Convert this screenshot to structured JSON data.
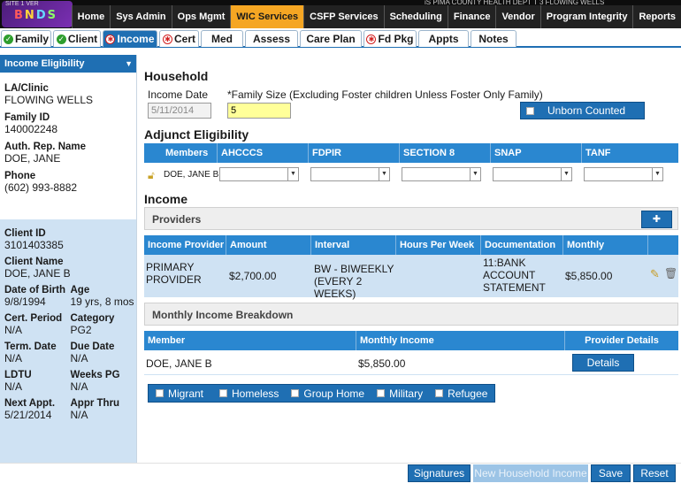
{
  "header": {
    "top_strip_text": "iS   PIMA COUNTY HEALTH DEPT T 3   FLOWING WELLS",
    "logo_top": "SITE 1 VER",
    "logo_letters": [
      "B",
      "N",
      "D",
      "S"
    ],
    "nav": [
      "Home",
      "Sys Admin",
      "Ops Mgmt",
      "WIC Services",
      "CSFP Services",
      "Scheduling",
      "Finance",
      "Vendor",
      "Program Integrity",
      "Reports"
    ],
    "nav_active": "WIC Services"
  },
  "tabs": [
    {
      "label": "Family",
      "status": "ok"
    },
    {
      "label": "Client",
      "status": "ok"
    },
    {
      "label": "Income",
      "status": "error",
      "active": true
    },
    {
      "label": "Cert",
      "status": "error"
    },
    {
      "label": "Med",
      "status": "none"
    },
    {
      "label": "Assess",
      "status": "none"
    },
    {
      "label": "Care Plan",
      "status": "none"
    },
    {
      "label": "Fd Pkg",
      "status": "error"
    },
    {
      "label": "Appts",
      "status": "none"
    },
    {
      "label": "Notes",
      "status": "none"
    }
  ],
  "left": {
    "header": "Income Eligibility",
    "la_clinic_label": "LA/Clinic",
    "la_clinic_value": "FLOWING WELLS",
    "family_id_label": "Family ID",
    "family_id_value": "140002248",
    "auth_rep_label": "Auth. Rep. Name",
    "auth_rep_value": "DOE, JANE",
    "phone_label": "Phone",
    "phone_value": "(602) 993-8882",
    "client_id_label": "Client ID",
    "client_id_value": "3101403385",
    "client_name_label": "Client Name",
    "client_name_value": "DOE, JANE B",
    "dob_label": "Date of Birth",
    "dob_value": "9/8/1994",
    "age_label": "Age",
    "age_value": "19 yrs, 8 mos",
    "cert_period_label": "Cert. Period",
    "cert_period_value": "N/A",
    "category_label": "Category",
    "category_value": "PG2",
    "term_date_label": "Term. Date",
    "term_date_value": "N/A",
    "due_date_label": "Due Date",
    "due_date_value": "N/A",
    "ldtu_label": "LDTU",
    "ldtu_value": "N/A",
    "weeks_pg_label": "Weeks PG",
    "weeks_pg_value": "N/A",
    "next_appt_label": "Next Appt.",
    "next_appt_value": "5/21/2014",
    "appr_thru_label": "Appr Thru",
    "appr_thru_value": "N/A"
  },
  "household": {
    "title": "Household",
    "income_date_label": "Income Date",
    "income_date_value": "5/11/2014",
    "family_size_label": "*Family Size (Excluding Foster children Unless Foster Only Family)",
    "family_size_value": "5",
    "unborn_label": "Unborn Counted"
  },
  "adjunct": {
    "title": "Adjunct Eligibility",
    "columns": [
      "Members",
      "AHCCCS",
      "FDPIR",
      "SECTION 8",
      "SNAP",
      "TANF"
    ],
    "member": "DOE, JANE B"
  },
  "income": {
    "title": "Income",
    "providers_title": "Providers",
    "add_label": "Add",
    "columns": [
      "Income Provider",
      "Amount",
      "Interval",
      "Hours Per Week",
      "Documentation",
      "Monthly"
    ],
    "row": {
      "provider": "PRIMARY PROVIDER",
      "amount": "$2,700.00",
      "interval": "BW - BIWEEKLY (EVERY 2 WEEKS)",
      "hours": "",
      "documentation": "11:BANK ACCOUNT STATEMENT",
      "monthly": "$5,850.00"
    },
    "breakdown_title": "Monthly Income Breakdown",
    "breakdown_columns": [
      "Member",
      "Monthly Income",
      "Provider Details"
    ],
    "breakdown_row": {
      "member": "DOE, JANE B",
      "monthly": "$5,850.00",
      "details": "Details"
    }
  },
  "flags": [
    "Migrant",
    "Homeless",
    "Group Home",
    "Military",
    "Refugee"
  ],
  "footer": {
    "signatures": "Signatures",
    "new_household": "New Household Income",
    "save": "Save",
    "reset": "Reset"
  },
  "colors": {
    "accent": "#1f6fb3",
    "active_nav": "#f5a623",
    "left_blue": "#cfe2f3",
    "error": "#d21f1f",
    "ok": "#2e9e2e"
  }
}
